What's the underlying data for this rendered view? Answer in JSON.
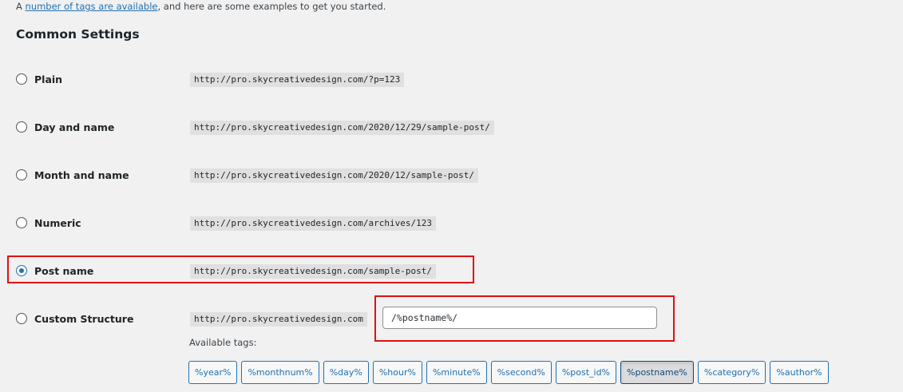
{
  "intro": {
    "prefix": "A ",
    "link_text": "number of tags are available",
    "suffix": ", and here are some examples to get you started."
  },
  "section_title": "Common Settings",
  "options": [
    {
      "label": "Plain",
      "example": "http://pro.skycreativedesign.com/?p=123",
      "checked": false
    },
    {
      "label": "Day and name",
      "example": "http://pro.skycreativedesign.com/2020/12/29/sample-post/",
      "checked": false
    },
    {
      "label": "Month and name",
      "example": "http://pro.skycreativedesign.com/2020/12/sample-post/",
      "checked": false
    },
    {
      "label": "Numeric",
      "example": "http://pro.skycreativedesign.com/archives/123",
      "checked": false
    },
    {
      "label": "Post name",
      "example": "http://pro.skycreativedesign.com/sample-post/",
      "checked": true
    },
    {
      "label": "Custom Structure",
      "example": "http://pro.skycreativedesign.com",
      "checked": false
    }
  ],
  "custom_structure": {
    "value": "/%postname%/"
  },
  "available_tags_label": "Available tags:",
  "tags": [
    {
      "label": "%year%",
      "active": false
    },
    {
      "label": "%monthnum%",
      "active": false
    },
    {
      "label": "%day%",
      "active": false
    },
    {
      "label": "%hour%",
      "active": false
    },
    {
      "label": "%minute%",
      "active": false
    },
    {
      "label": "%second%",
      "active": false
    },
    {
      "label": "%post_id%",
      "active": false
    },
    {
      "label": "%postname%",
      "active": true
    },
    {
      "label": "%category%",
      "active": false
    },
    {
      "label": "%author%",
      "active": false
    }
  ],
  "colors": {
    "accent": "#2271b1",
    "highlight": "#e01010",
    "background": "#f1f1f1"
  }
}
